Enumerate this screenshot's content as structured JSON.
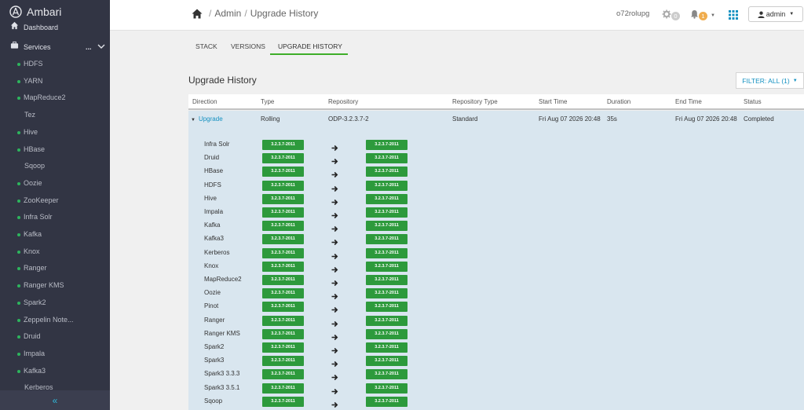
{
  "app": {
    "title": "Ambari"
  },
  "sidebar": {
    "dashboard_label": "Dashboard",
    "services_label": "Services",
    "services_more": "...",
    "collapse_glyph": "«",
    "services": [
      {
        "name": "HDFS",
        "status": true
      },
      {
        "name": "YARN",
        "status": true
      },
      {
        "name": "MapReduce2",
        "status": true
      },
      {
        "name": "Tez",
        "status": false
      },
      {
        "name": "Hive",
        "status": true
      },
      {
        "name": "HBase",
        "status": true
      },
      {
        "name": "Sqoop",
        "status": false
      },
      {
        "name": "Oozie",
        "status": true
      },
      {
        "name": "ZooKeeper",
        "status": true
      },
      {
        "name": "Infra Solr",
        "status": true
      },
      {
        "name": "Kafka",
        "status": true
      },
      {
        "name": "Knox",
        "status": true
      },
      {
        "name": "Ranger",
        "status": true
      },
      {
        "name": "Ranger KMS",
        "status": true
      },
      {
        "name": "Spark2",
        "status": true
      },
      {
        "name": "Zeppelin Note...",
        "status": true
      },
      {
        "name": "Druid",
        "status": true
      },
      {
        "name": "Impala",
        "status": true
      },
      {
        "name": "Kafka3",
        "status": true
      },
      {
        "name": "Kerberos",
        "status": false
      }
    ]
  },
  "header": {
    "breadcrumb": [
      "Admin",
      "Upgrade History"
    ],
    "breadcrumb_sep": "/",
    "cluster_name": "o72rolupg",
    "ops_count": "0",
    "alerts_count": "1",
    "user": "admin"
  },
  "tabs": [
    {
      "label": "STACK",
      "active": false
    },
    {
      "label": "VERSIONS",
      "active": false
    },
    {
      "label": "UPGRADE HISTORY",
      "active": true
    }
  ],
  "page": {
    "title": "Upgrade History",
    "filter_label": "FILTER: ALL (1)"
  },
  "table": {
    "columns": [
      "Direction",
      "Type",
      "Repository",
      "Repository Type",
      "Start Time",
      "Duration",
      "End Time",
      "Status"
    ],
    "upgrade_row": {
      "direction": "Upgrade",
      "type": "Rolling",
      "repository": "ODP-3.2.3.7-2",
      "repository_type": "Standard",
      "start_time": "Fri Aug 07 2026 20:48",
      "duration": "35s",
      "end_time": "Fri Aug 07 2026 20:48",
      "status": "Completed"
    },
    "service_versions": [
      {
        "service": "Infra Solr",
        "from": "3.2.3.7-2011",
        "to": "3.2.3.7-2011"
      },
      {
        "service": "Druid",
        "from": "3.2.3.7-2011",
        "to": "3.2.3.7-2011"
      },
      {
        "service": "HBase",
        "from": "3.2.3.7-2011",
        "to": "3.2.3.7-2011"
      },
      {
        "service": "HDFS",
        "from": "3.2.3.7-2011",
        "to": "3.2.3.7-2011"
      },
      {
        "service": "Hive",
        "from": "3.2.3.7-2011",
        "to": "3.2.3.7-2011"
      },
      {
        "service": "Impala",
        "from": "3.2.3.7-2011",
        "to": "3.2.3.7-2011"
      },
      {
        "service": "Kafka",
        "from": "3.2.3.7-2011",
        "to": "3.2.3.7-2011"
      },
      {
        "service": "Kafka3",
        "from": "3.2.3.7-2011",
        "to": "3.2.3.7-2011"
      },
      {
        "service": "Kerberos",
        "from": "3.2.3.7-2011",
        "to": "3.2.3.7-2011"
      },
      {
        "service": "Knox",
        "from": "3.2.3.7-2011",
        "to": "3.2.3.7-2011"
      },
      {
        "service": "MapReduce2",
        "from": "3.2.3.7-2011",
        "to": "3.2.3.7-2011"
      },
      {
        "service": "Oozie",
        "from": "3.2.3.7-2011",
        "to": "3.2.3.7-2011"
      },
      {
        "service": "Pinot",
        "from": "3.2.3.7-2011",
        "to": "3.2.3.7-2011"
      },
      {
        "service": "Ranger",
        "from": "3.2.3.7-2011",
        "to": "3.2.3.7-2011"
      },
      {
        "service": "Ranger KMS",
        "from": "3.2.3.7-2011",
        "to": "3.2.3.7-2011"
      },
      {
        "service": "Spark2",
        "from": "3.2.3.7-2011",
        "to": "3.2.3.7-2011"
      },
      {
        "service": "Spark3",
        "from": "3.2.3.7-2011",
        "to": "3.2.3.7-2011"
      },
      {
        "service": "Spark3 3.3.3",
        "from": "3.2.3.7-2011",
        "to": "3.2.3.7-2011"
      },
      {
        "service": "Spark3 3.5.1",
        "from": "3.2.3.7-2011",
        "to": "3.2.3.7-2011"
      },
      {
        "service": "Sqoop",
        "from": "3.2.3.7-2011",
        "to": "3.2.3.7-2011"
      }
    ]
  },
  "colors": {
    "sidebar_bg": "#323544",
    "status_green": "#2db55d",
    "version_badge": "#2d9a3c",
    "link_blue": "#1491c1",
    "tab_underline": "#3fae2a",
    "row_bg": "#d9e6ef",
    "alert_orange": "#f0ad4e"
  },
  "icons": [
    "ambari-logo-icon",
    "home-icon",
    "briefcase-icon",
    "chevron-down-icon",
    "gear-icon",
    "bell-icon",
    "apps-grid-icon",
    "user-icon",
    "caret-down-icon",
    "arrow-right-icon",
    "collapse-icon"
  ]
}
